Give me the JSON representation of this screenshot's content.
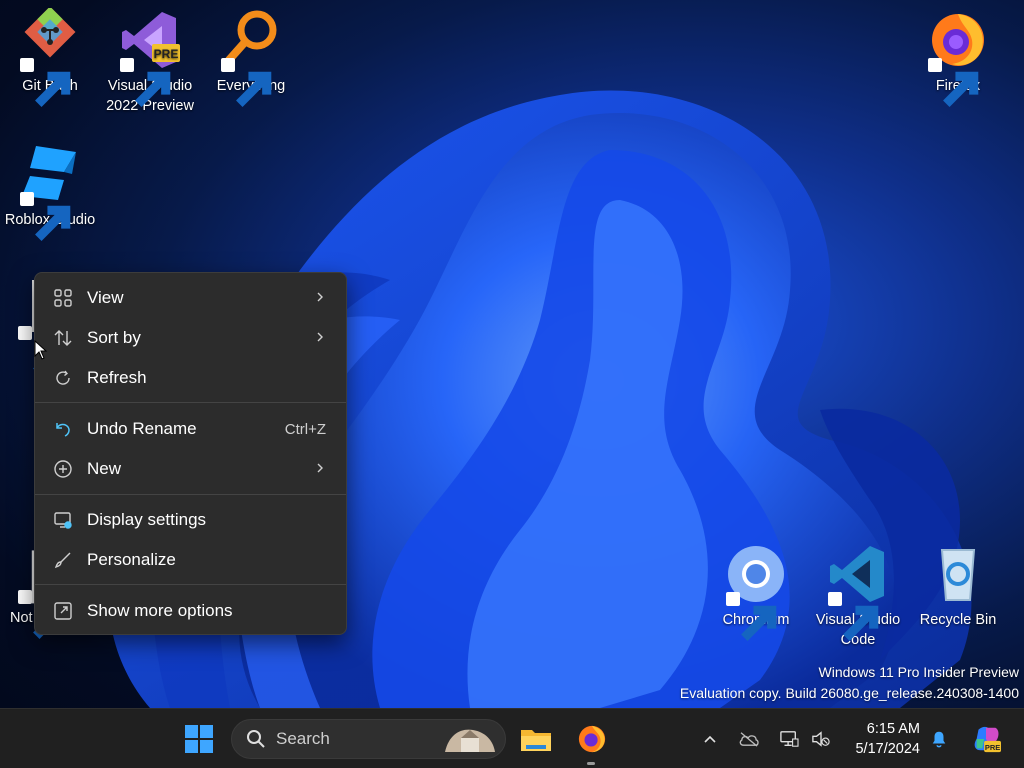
{
  "desktop": {
    "icons": [
      {
        "label": "Git Bash",
        "icon": "git-bash-icon"
      },
      {
        "label": "Visual Studio 2022 Preview",
        "line1": "Visual Studio",
        "line2": "2022 Preview",
        "badge": "PRE",
        "icon": "visual-studio-icon"
      },
      {
        "label": "Everything",
        "icon": "everything-search-icon"
      },
      {
        "label": "Firefox",
        "icon": "firefox-icon"
      },
      {
        "label": "Roblox Studio",
        "icon": "roblox-studio-icon"
      },
      {
        "label": "Not",
        "icon": "notepad-icon"
      },
      {
        "label": "Chromium",
        "icon": "chromium-icon"
      },
      {
        "label": "Visual Studio Code",
        "line1": "Visual Studio",
        "line2": "Code",
        "icon": "vscode-icon"
      },
      {
        "label": "Recycle Bin",
        "icon": "recycle-bin-icon"
      }
    ],
    "watermark": {
      "line1": "Windows 11 Pro Insider Preview",
      "line2": "Evaluation copy. Build 26080.ge_release.240308-1400"
    }
  },
  "context_menu": {
    "items": [
      {
        "label": "View",
        "icon": "grid-view-icon",
        "submenu": true
      },
      {
        "label": "Sort by",
        "icon": "sort-icon",
        "submenu": true
      },
      {
        "label": "Refresh",
        "icon": "refresh-icon"
      },
      {
        "label": "Undo Rename",
        "icon": "undo-icon",
        "shortcut": "Ctrl+Z"
      },
      {
        "label": "New",
        "icon": "plus-circle-icon",
        "submenu": true
      },
      {
        "label": "Display settings",
        "icon": "display-settings-icon"
      },
      {
        "label": "Personalize",
        "icon": "brush-icon"
      },
      {
        "label": "Show more options",
        "icon": "expand-options-icon"
      }
    ]
  },
  "taskbar": {
    "search_label": "Search",
    "pinned": [
      "start-icon",
      "file-explorer-icon",
      "firefox-icon"
    ],
    "tray": [
      "chevron-up-icon",
      "cloud-offline-icon",
      "network-icon",
      "volume-muted-icon"
    ],
    "time": "6:15 AM",
    "date": "5/17/2024",
    "colors": {
      "start_blue": "#3ea6ff",
      "accent": "#0067c0"
    }
  }
}
